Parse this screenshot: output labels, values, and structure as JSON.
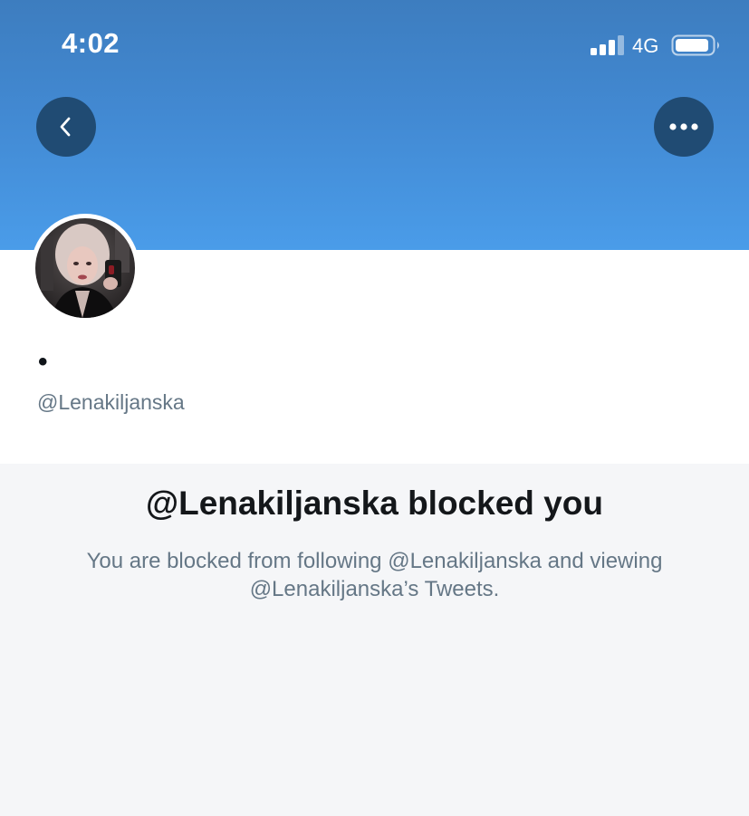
{
  "status_bar": {
    "time": "4:02",
    "network": "4G",
    "signal_icon": "signal-bars-icon",
    "battery_icon": "battery-icon"
  },
  "header": {
    "back_icon": "chevron-left-icon",
    "more_icon": "ellipsis-icon"
  },
  "profile": {
    "display_name": "•",
    "handle": "@Lenakiljanska"
  },
  "blocked": {
    "title": "@Lenakiljanska blocked you",
    "description": "You are blocked from following @Lenakiljanska and viewing @Lenakiljanska’s Tweets."
  },
  "colors": {
    "banner_top": "#3d7dbf",
    "banner_bottom": "#4a9ce9",
    "button_bg": "#204b73",
    "secondary_text": "#657786",
    "primary_text": "#14171a"
  }
}
